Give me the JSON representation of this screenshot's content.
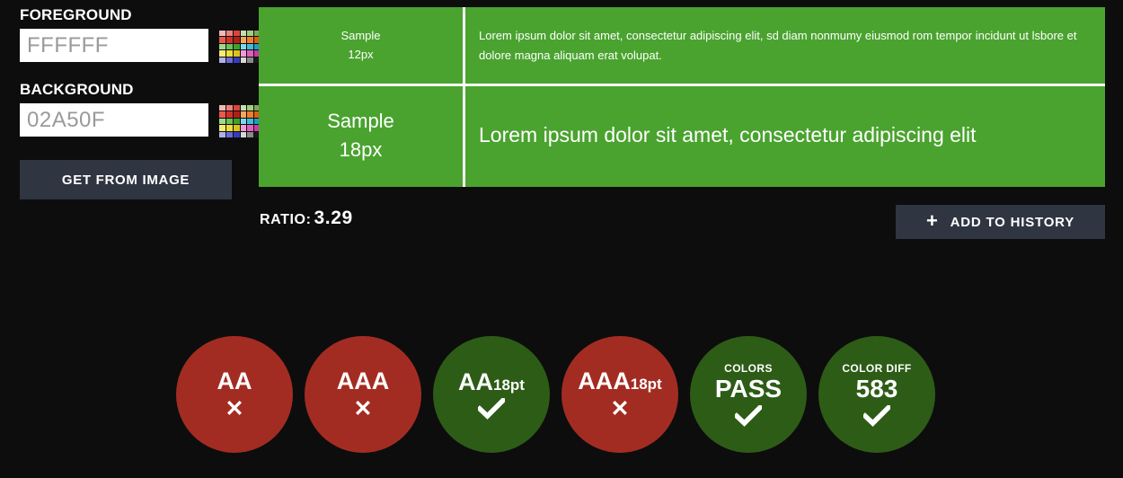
{
  "theme": {
    "page_bg": "#0d0d0d",
    "panel_green": "#4aa32f",
    "badge_pass": "#2d5c16",
    "badge_fail": "#a32c22",
    "button_bg": "#2f3541",
    "text_white": "#ffffff",
    "input_text": "#9a9a9a"
  },
  "controls": {
    "foreground": {
      "label": "FOREGROUND",
      "value": "FFFFFF",
      "placeholder": "FFFFFF",
      "picker_icon": "color-palette-icon"
    },
    "background": {
      "label": "BACKGROUND",
      "value": "02A50F",
      "placeholder": "02A50F",
      "picker_icon": "color-palette-icon"
    },
    "get_from_image_label": "GET FROM IMAGE"
  },
  "palette_swatches": [
    "#f2b8b5",
    "#e8837d",
    "#d9463c",
    "#c9ddb0",
    "#9fcf7d",
    "#7aa85a",
    "#e85a4a",
    "#d2322a",
    "#b02018",
    "#f0a860",
    "#ef7f2a",
    "#d95f14",
    "#9fd88f",
    "#6fc05a",
    "#3fa02e",
    "#7fd8e8",
    "#3fbcd8",
    "#1f9ec0",
    "#f5eb70",
    "#efdd3a",
    "#d8c41a",
    "#f09ad8",
    "#e05ec0",
    "#c03fa8",
    "#b0b0e8",
    "#6a6ad8",
    "#3a3ac0",
    "#d8d8d8",
    "#8a8a8a",
    "#1a1a1a"
  ],
  "preview": {
    "sample_small": {
      "line1": "Sample",
      "line2": "12px"
    },
    "sample_large": {
      "line1": "Sample",
      "line2": "18px"
    },
    "lorem_small": "Lorem ipsum dolor sit amet, consectetur adipiscing elit, sd diam nonmumy eiusmod rom tempor incidunt ut lsbore et dolore magna aliquam erat volupat.",
    "lorem_large": "Lorem ipsum dolor sit amet, consectetur adipiscing elit"
  },
  "ratio": {
    "label": "RATIO:",
    "value": "3.29"
  },
  "add_history": {
    "icon": "plus-icon",
    "label": "ADD TO HISTORY"
  },
  "badges": [
    {
      "top_label": "",
      "title": "AA",
      "title_sub": "",
      "value": "",
      "state": "fail",
      "mark": "x",
      "name": "badge-aa"
    },
    {
      "top_label": "",
      "title": "AAA",
      "title_sub": "",
      "value": "",
      "state": "fail",
      "mark": "x",
      "name": "badge-aaa"
    },
    {
      "top_label": "",
      "title": "AA",
      "title_sub": "18pt",
      "value": "",
      "state": "pass",
      "mark": "check",
      "name": "badge-aa-18pt"
    },
    {
      "top_label": "",
      "title": "AAA",
      "title_sub": "18pt",
      "value": "",
      "state": "fail",
      "mark": "x",
      "name": "badge-aaa-18pt"
    },
    {
      "top_label": "COLORS",
      "title": "",
      "title_sub": "",
      "value": "PASS",
      "state": "pass",
      "mark": "check",
      "name": "badge-colors"
    },
    {
      "top_label": "COLOR DIFF",
      "title": "",
      "title_sub": "",
      "value": "583",
      "state": "pass",
      "mark": "check",
      "name": "badge-color-diff"
    }
  ]
}
